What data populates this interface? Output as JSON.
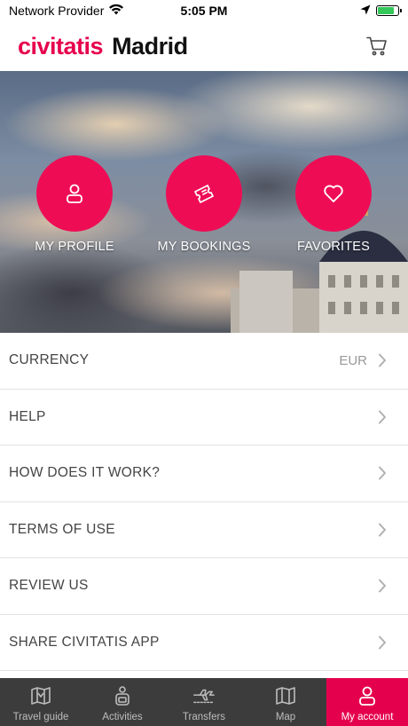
{
  "status": {
    "carrier": "Network Provider",
    "time": "5:05 PM",
    "battery_level": 0.8
  },
  "header": {
    "brand": "civitatis",
    "city": "Madrid",
    "cart_icon": "cart-icon"
  },
  "colors": {
    "accent": "#e6004c",
    "tabbar": "#3c3c3c",
    "text": "#444444",
    "muted": "#999999"
  },
  "hero_actions": [
    {
      "label": "MY PROFILE",
      "icon": "user-icon"
    },
    {
      "label": "MY BOOKINGS",
      "icon": "ticket-icon"
    },
    {
      "label": "FAVORITES",
      "icon": "heart-icon"
    }
  ],
  "menu": [
    {
      "label": "CURRENCY",
      "value": "EUR"
    },
    {
      "label": "HELP"
    },
    {
      "label": "HOW DOES IT WORK?"
    },
    {
      "label": "TERMS OF USE"
    },
    {
      "label": "REVIEW US"
    },
    {
      "label": "SHARE CIVITATIS APP"
    }
  ],
  "tabs": [
    {
      "label": "Travel guide",
      "icon": "map-guide-icon",
      "active": false
    },
    {
      "label": "Activities",
      "icon": "activities-icon",
      "active": false
    },
    {
      "label": "Transfers",
      "icon": "transfers-icon",
      "active": false
    },
    {
      "label": "Map",
      "icon": "map-icon",
      "active": false
    },
    {
      "label": "My account",
      "icon": "account-icon",
      "active": true
    }
  ]
}
